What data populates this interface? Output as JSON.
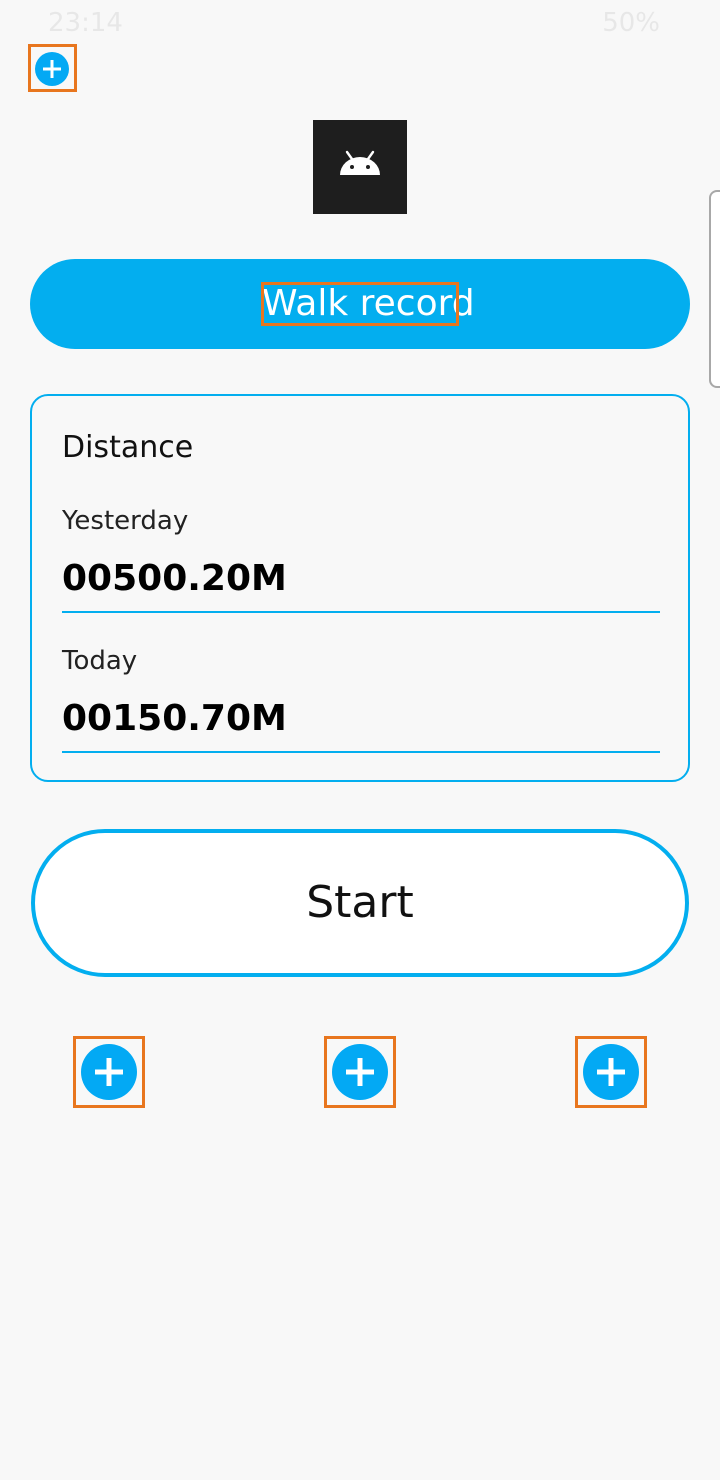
{
  "status_bar": {
    "time": "23:14",
    "battery": "50%"
  },
  "app": {
    "title": "Walk record",
    "logo_icon": "android-icon"
  },
  "distance": {
    "heading": "Distance",
    "yesterday_label": "Yesterday",
    "yesterday_value": "00500.20M",
    "today_label": "Today",
    "today_value": "00150.70M"
  },
  "start_button": {
    "label": "Start"
  },
  "colors": {
    "accent": "#03aeef",
    "annotation": "#e8761e",
    "logo_bg": "#1e1e1e"
  },
  "icons": [
    "plus-circle-icon",
    "android-icon"
  ]
}
